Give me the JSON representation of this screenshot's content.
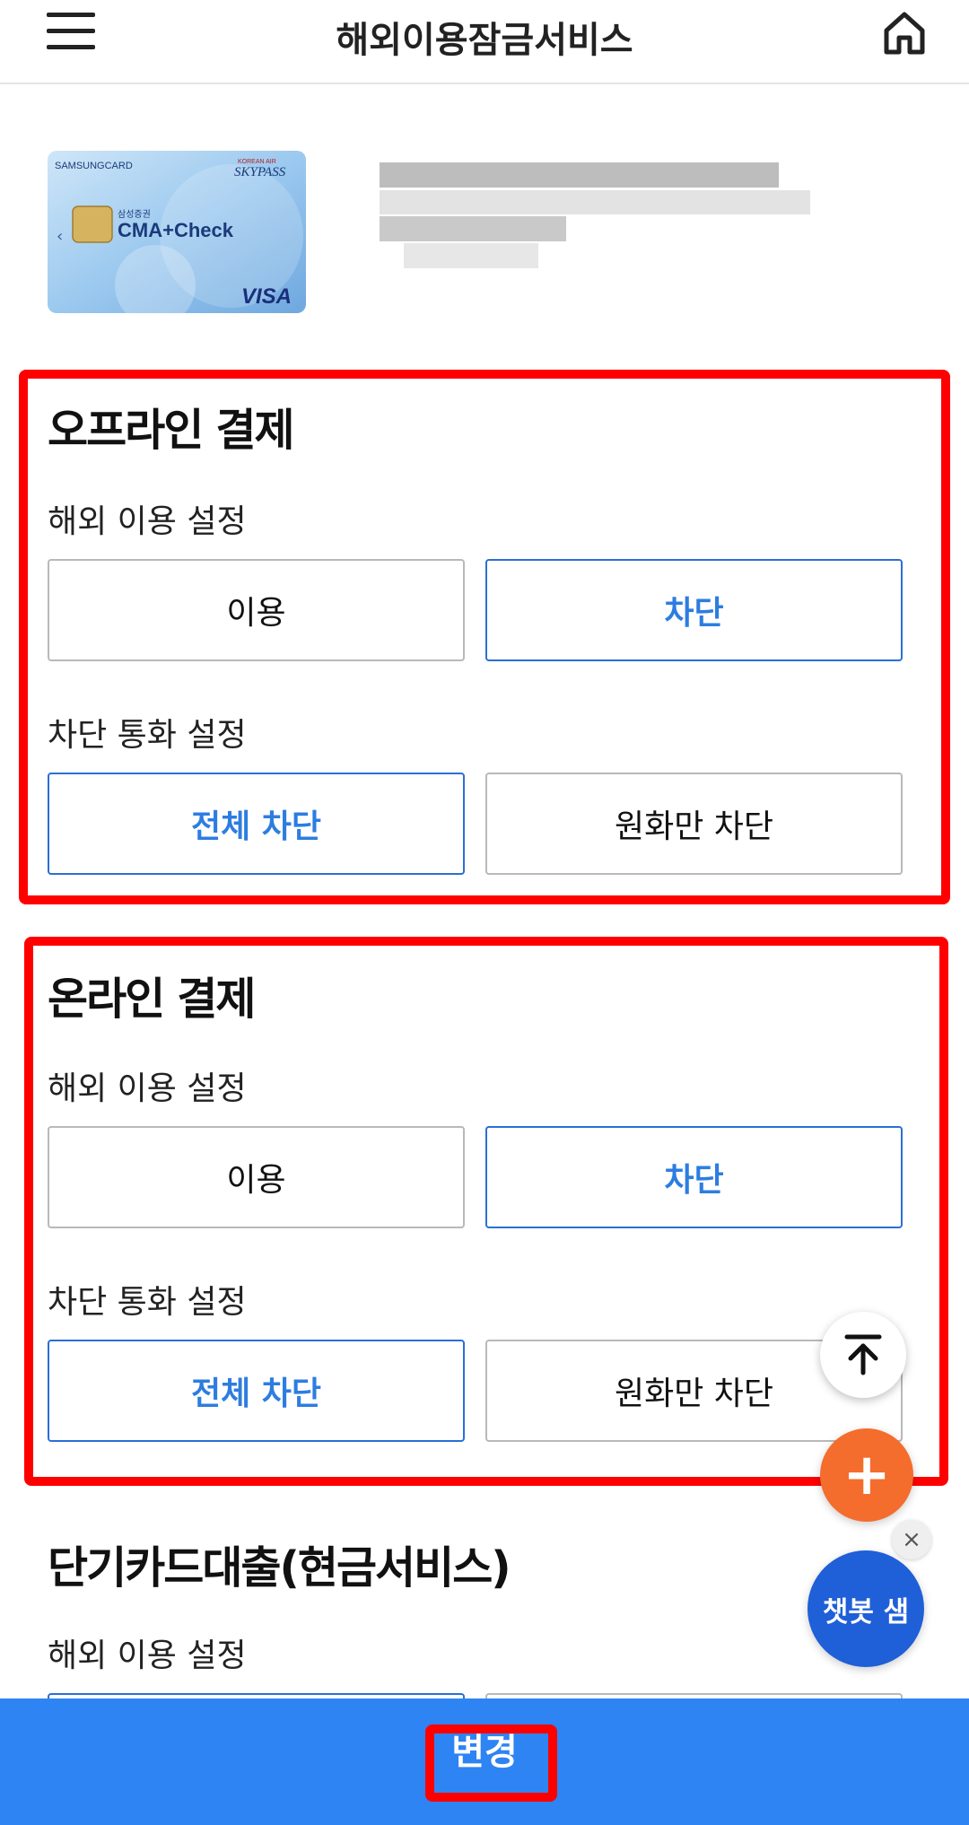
{
  "header": {
    "title": "해외이용잠금서비스",
    "menu_icon": "hamburger-menu-icon",
    "home_icon": "home-icon"
  },
  "card": {
    "brand": "SAMSUNGCARD",
    "partner": "SKYPASS",
    "product": "CMA+Check",
    "issuer": "삼성증권",
    "network": "VISA",
    "partner_small": "KOREAN AIR"
  },
  "sections": {
    "offline": {
      "title": "오프라인 결제",
      "overseas_label": "해외 이용 설정",
      "use_label": "이용",
      "block_label": "차단",
      "currency_label": "차단 통화 설정",
      "all_block_label": "전체 차단",
      "won_only_label": "원화만 차단"
    },
    "online": {
      "title": "온라인 결제",
      "overseas_label": "해외 이용 설정",
      "use_label": "이용",
      "block_label": "차단",
      "currency_label": "차단 통화 설정",
      "all_block_label": "전체 차단",
      "won_only_label": "원화만 차단"
    },
    "cash": {
      "title": "단기카드대출(현금서비스)",
      "overseas_label": "해외 이용 설정"
    }
  },
  "floating": {
    "top_icon": "arrow-up-icon",
    "plus_label": "+",
    "chatbot_label": "챗봇 샘",
    "close_label": "×"
  },
  "footer": {
    "change_label": "변경"
  },
  "colors": {
    "accent": "#2d7de0",
    "bottom_bar": "#2e84f3",
    "highlight": "#ff0000",
    "fab_orange": "#f46d2d",
    "chatbot": "#1f5fd8"
  }
}
